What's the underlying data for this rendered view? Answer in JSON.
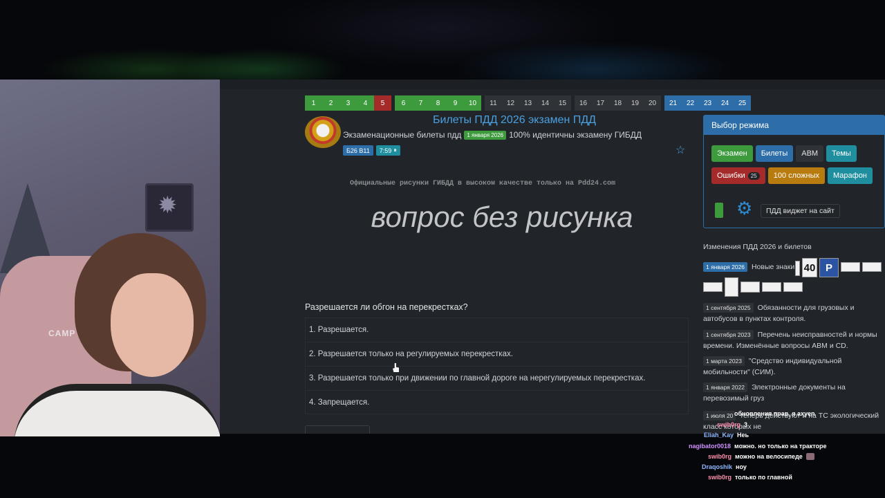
{
  "tickets": {
    "group1": [
      "1",
      "2",
      "3",
      "4",
      "5"
    ],
    "group2": [
      "6",
      "7",
      "8",
      "9",
      "10"
    ],
    "group3": [
      "11",
      "12",
      "13",
      "14",
      "15"
    ],
    "group4": [
      "16",
      "17",
      "18",
      "19",
      "20"
    ],
    "group5": [
      "21",
      "22",
      "23",
      "24",
      "25"
    ],
    "current": "5"
  },
  "header": {
    "title": "Билеты ПДД 2026 экзамен ПДД",
    "subtitle_prefix": "Экзаменационные билеты пдд",
    "date_badge": "1 января 2026",
    "subtitle_suffix": "100% идентичны экзамену ГИБДД",
    "ticket_chip": "Б26 В11",
    "timer_chip": "7:59",
    "pause_icon": "⏸"
  },
  "question": {
    "watermark": "Официальные рисунки ГИБДД в высоком качестве только на Pdd24.com",
    "no_image_text": "вопрос без рисунка",
    "text": "Разрешается ли обгон на перекрестках?",
    "answers": [
      "1. Разрешается.",
      "2. Разрешается только на регулируемых перекрестках.",
      "3. Разрешается только при движении по главной дороге на нерегулируемых перекрестках.",
      "4. Запрещается."
    ]
  },
  "mode_panel": {
    "title": "Выбор режима",
    "row1": [
      "Экзамен",
      "Билеты",
      "ABM",
      "Темы"
    ],
    "errors_label": "Ошибки",
    "errors_count": "25",
    "hard_label": "100 сложных",
    "marathon_label": "Марафон",
    "widget_label": "ПДД виджет на сайт"
  },
  "news": {
    "title": "Изменения ПДД 2026 и билетов",
    "items": [
      {
        "date": "1 января 2026",
        "text": "Новые знаки"
      },
      {
        "date": "1 сентября 2025",
        "text": "Обязанности для грузовых и автобусов в пунктах контроля."
      },
      {
        "date": "1 сентября 2023",
        "text": "Перечень неисправностей и нормы времени. Изменённые вопросы ABM и CD."
      },
      {
        "date": "1 марта 2023",
        "text": "\"Средство индивидуальной мобильности\" (СИМ)."
      },
      {
        "date": "1 января 2022",
        "text": "Электронные документы на перевозимый груз"
      },
      {
        "date": "1 июля 20",
        "text": "теперь действуют и на ТС экологический класс которых не"
      }
    ],
    "sign_40": "40",
    "sign_p": "P"
  },
  "chat": [
    {
      "nick": "",
      "text": "обновления прав, я ахуеn"
    },
    {
      "nick": "swib0rg",
      "text": "3"
    },
    {
      "nick": "Eliah_Kay",
      "text": "Неь"
    },
    {
      "nick": "nagibator0018",
      "text": "можно. но только на тракторе"
    },
    {
      "nick": "swib0rg",
      "text": "можно на велосипеде"
    },
    {
      "nick": "Draqoshik",
      "text": "ноу"
    },
    {
      "nick": "swib0rg",
      "text": "только по главной"
    }
  ],
  "webcam": {
    "chair_logo": "CAMP"
  }
}
